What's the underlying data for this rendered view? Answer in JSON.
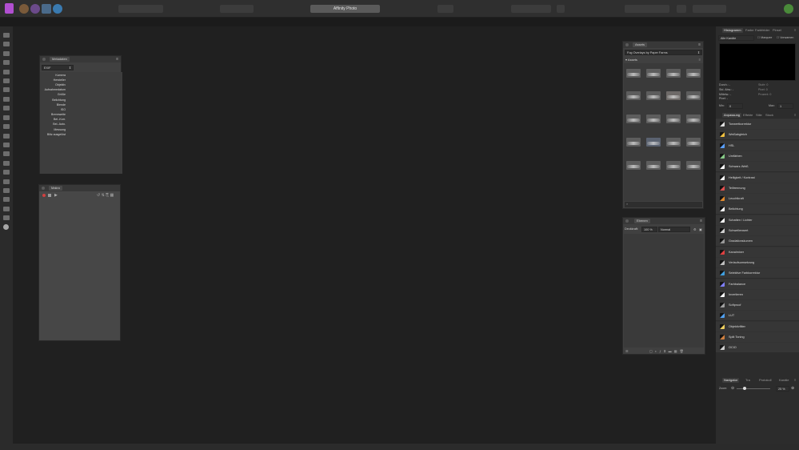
{
  "app": {
    "title": "Affinity Photo",
    "accent": "#b14fd1"
  },
  "metadata_panel": {
    "title": "Metadaten",
    "dropdown": "EXIF",
    "rows": [
      "Kamera",
      "Hersteller",
      "Objektiv",
      "Aufnahmedatum",
      "Größe",
      "Belichtung",
      "Blende",
      "ISO",
      "Brennweite",
      "Bel.-Korr.",
      "Bel.-Auto.",
      "Messung",
      "Blitz ausgelöst"
    ]
  },
  "macro_panel": {
    "title": "Makro"
  },
  "assets_panel": {
    "title": "Assets",
    "category": "Fog Overlays by Paper Farms",
    "group": "Assets",
    "item_count": 20
  },
  "layers_panel": {
    "title": "Ebenen",
    "opacity_label": "Deckkraft:",
    "opacity_value": "100 %",
    "blend_mode": "Normal"
  },
  "histogram": {
    "tabs": [
      "Histogramm",
      "Farbe",
      "Farbfelder",
      "Pinsel"
    ],
    "channel": "Alle Kanäle",
    "checkbox_marquee": "Marquee",
    "checkbox_warnings": "Vorwarnen",
    "stats_left": [
      "Durch.: -",
      "Std. Abw.: -",
      "Mittelw.: -",
      "Pixel: -"
    ],
    "stats_right": [
      "Stufe: 0",
      "Pixel: 0",
      "Prozent: 0"
    ],
    "min_label": "Min:",
    "min_value": "0",
    "max_label": "Max:",
    "max_value": "1"
  },
  "adjustments": {
    "tabs": [
      "Anpassung",
      "Effekte",
      "Stile",
      "Stock"
    ],
    "items": [
      {
        "label": "Tonwertkorrektur",
        "icon": "levels-icon",
        "color": "#e0e0e0"
      },
      {
        "label": "Weißabgleich",
        "icon": "white-balance-icon",
        "color": "#f0c040"
      },
      {
        "label": "HSL",
        "icon": "hsl-icon",
        "color": "#5aa0ff"
      },
      {
        "label": "Umfärben",
        "icon": "recolor-icon",
        "color": "#88cc88"
      },
      {
        "label": "Schwarz-Weiß",
        "icon": "black-white-icon",
        "color": "#ffffff"
      },
      {
        "label": "Helligkeit / Kontrast",
        "icon": "brightness-contrast-icon",
        "color": "#ffffff"
      },
      {
        "label": "Teiltrennung",
        "icon": "split-icon",
        "color": "#e05050"
      },
      {
        "label": "Leuchtkraft",
        "icon": "vibrance-icon",
        "color": "#e08a30"
      },
      {
        "label": "Belichtung",
        "icon": "exposure-icon",
        "color": "#ffffff"
      },
      {
        "label": "Schatten / Lichter",
        "icon": "shadows-highlights-icon",
        "color": "#ffffff"
      },
      {
        "label": "Schwellenwert",
        "icon": "threshold-icon",
        "color": "#d0d0d0"
      },
      {
        "label": "Gradationskurven",
        "icon": "curves-icon",
        "color": "#9a9a9a"
      },
      {
        "label": "Kanalmixer",
        "icon": "channel-mixer-icon",
        "color": "#e04040"
      },
      {
        "label": "Verlaufsumsetzung",
        "icon": "gradient-map-icon",
        "color": "#c0c0c0"
      },
      {
        "label": "Selektive Farbkorrektur",
        "icon": "selective-color-icon",
        "color": "#40a0e0"
      },
      {
        "label": "Farbbalance",
        "icon": "color-balance-icon",
        "color": "#8080ff"
      },
      {
        "label": "Invertieren",
        "icon": "invert-icon",
        "color": "#ffffff"
      },
      {
        "label": "Softproof",
        "icon": "soft-proof-icon",
        "color": "#a0a0a0"
      },
      {
        "label": "LUT",
        "icon": "lut-icon",
        "color": "#50a0f0"
      },
      {
        "label": "Objektivfilter",
        "icon": "lens-filter-icon",
        "color": "#f0d060"
      },
      {
        "label": "Split Toning",
        "icon": "split-toning-icon",
        "color": "#d08040"
      },
      {
        "label": "OCIO",
        "icon": "ocio-icon",
        "color": "#d0d0d0"
      }
    ]
  },
  "navigator": {
    "tabs": [
      "Navigator",
      "Transformieren",
      "Protokoll",
      "Kanäle"
    ],
    "visible_tabs": [
      "Navigator",
      "Tra",
      "Protokoll",
      "Kanäle"
    ],
    "zoom_label": "Zoom:",
    "zoom_value": "25 %",
    "zoom_level": 0.25
  }
}
